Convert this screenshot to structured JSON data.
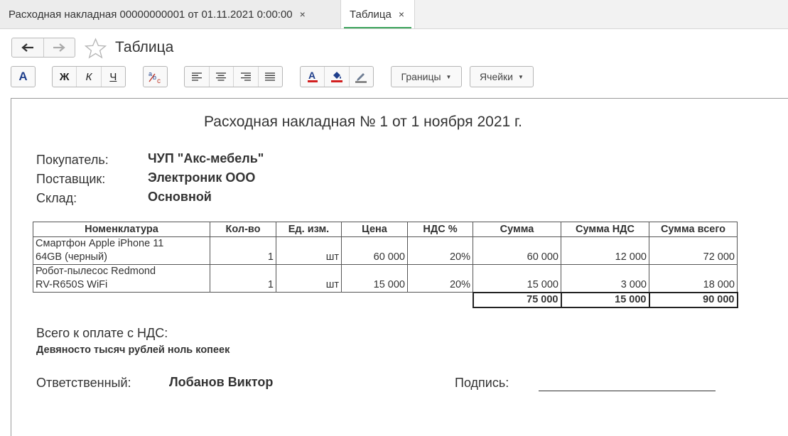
{
  "tabs": [
    {
      "label": "Расходная накладная 00000000001 от 01.11.2021 0:00:00",
      "close": "×"
    },
    {
      "label": "Таблица",
      "close": "×"
    }
  ],
  "header": {
    "title": "Таблица"
  },
  "toolbar": {
    "font_btn": "A",
    "bold": "Ж",
    "italic": "К",
    "underline": "Ч",
    "borders": "Границы",
    "cells": "Ячейки"
  },
  "accent_color": "#3aa35a",
  "document": {
    "title": "Расходная накладная № 1 от 1 ноября 2021 г.",
    "buyer_label": "Покупатель:",
    "buyer": "ЧУП \"Акс-мебель\"",
    "supplier_label": "Поставщик:",
    "supplier": "Электроник ООО",
    "warehouse_label": "Склад:",
    "warehouse": "Основной",
    "columns": [
      "Номенклатура",
      "Кол-во",
      "Ед. изм.",
      "Цена",
      "НДС %",
      "Сумма",
      "Сумма НДС",
      "Сумма всего"
    ],
    "rows": [
      {
        "name1": "Смартфон Apple iPhone 11",
        "name2": "64GB (черный)",
        "qty": "1",
        "unit": "шт",
        "price": "60 000",
        "vat_rate": "20%",
        "sum": "60 000",
        "vat_sum": "12 000",
        "total": "72 000"
      },
      {
        "name1": "Робот-пылесос Redmond",
        "name2": "RV-R650S WiFi",
        "qty": "1",
        "unit": "шт",
        "price": "15 000",
        "vat_rate": "20%",
        "sum": "15 000",
        "vat_sum": "3 000",
        "total": "18 000"
      }
    ],
    "totals": {
      "sum": "75 000",
      "vat_sum": "15 000",
      "total": "90 000"
    },
    "total_label": "Всего к оплате с НДС:",
    "total_words": "Девяносто тысяч рублей ноль копеек",
    "responsible_label": "Ответственный:",
    "responsible": "Лобанов Виктор",
    "signature_label": "Подпись:"
  }
}
